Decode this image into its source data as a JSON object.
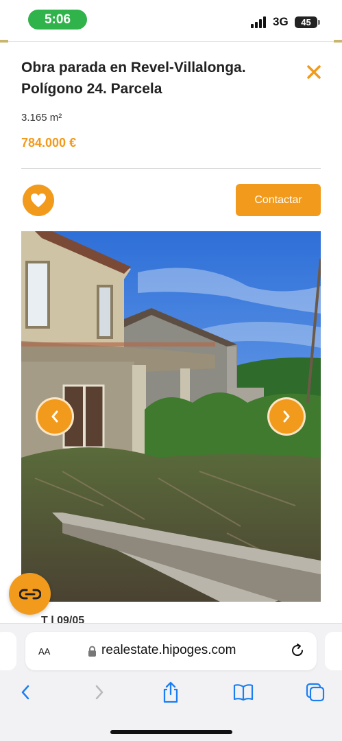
{
  "status_bar": {
    "time": "5:06",
    "network": "3G",
    "battery": "45"
  },
  "listing": {
    "title": "Obra parada en Revel-Villalonga. Polígono 24. Parcela",
    "area": "3.165 m²",
    "price": "784.000 €",
    "contact_label": "Contactar",
    "peek_text": "T l 09/05"
  },
  "browser": {
    "text_size_label": "AA",
    "url": "realestate.hipoges.com"
  },
  "colors": {
    "accent": "#f29a1b",
    "status_green": "#2fb34a"
  },
  "icons": [
    "heart-icon",
    "close-icon",
    "chevron-left-icon",
    "chevron-right-icon",
    "chat-icon",
    "lock-icon",
    "reload-icon",
    "back-icon",
    "forward-icon",
    "share-icon",
    "bookmarks-icon",
    "tabs-icon"
  ]
}
